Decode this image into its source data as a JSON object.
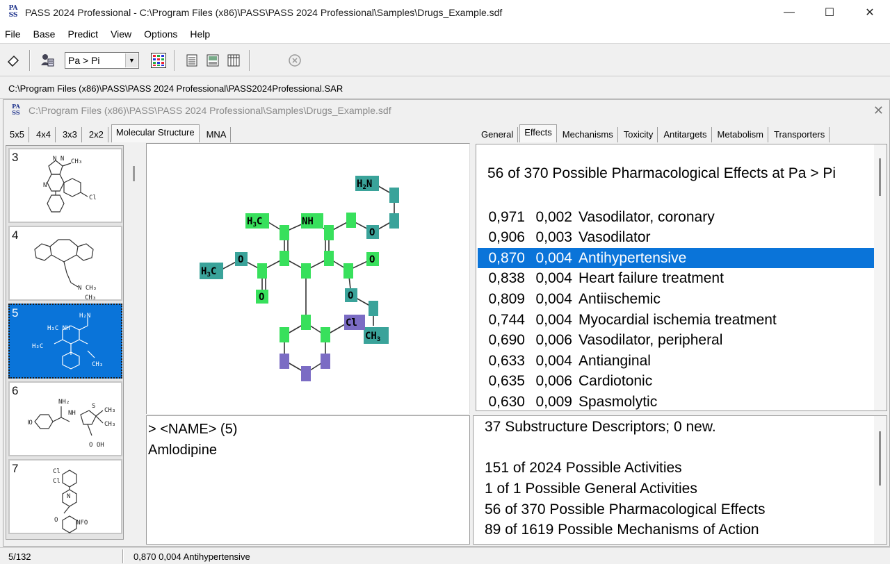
{
  "window": {
    "title": "PASS 2024 Professional - C:\\Program Files (x86)\\PASS\\PASS 2024 Professional\\Samples\\Drugs_Example.sdf",
    "app_icon_text": "PASS",
    "minimize": "—",
    "maximize": "☐",
    "close": "✕"
  },
  "menu": [
    "File",
    "Base",
    "Predict",
    "View",
    "Options",
    "Help"
  ],
  "toolbar": {
    "threshold_select": "Pa > Pi",
    "icons": [
      "eraser-icon",
      "user-settings-icon",
      "color-grid-icon",
      "document-icon",
      "image-icon",
      "table-icon",
      "stop-icon"
    ]
  },
  "sar_path": "C:\\Program Files (x86)\\PASS\\PASS 2024 Professional\\PASS2024Professional.SAR",
  "child_window": {
    "title": "C:\\Program Files (x86)\\PASS\\PASS 2024 Professional\\Samples\\Drugs_Example.sdf",
    "close": "✕"
  },
  "left_tabs": [
    "5x5",
    "4x4",
    "3x3",
    "2x2",
    "Molecular Structure",
    "MNA"
  ],
  "left_active_tab": "Molecular Structure",
  "right_tabs": [
    "General",
    "Effects",
    "Mechanisms",
    "Toxicity",
    "Antitargets",
    "Metabolism",
    "Transporters"
  ],
  "right_active_tab": "Effects",
  "thumbnails": [
    {
      "num": "3",
      "selected": false
    },
    {
      "num": "4",
      "selected": false
    },
    {
      "num": "5",
      "selected": true
    },
    {
      "num": "6",
      "selected": false
    },
    {
      "num": "7",
      "selected": false
    }
  ],
  "molecule": {
    "atom_labels": {
      "h2n": [
        "H",
        "2",
        "N"
      ],
      "h3c_top": [
        "H",
        "3",
        "C"
      ],
      "nh": "NH",
      "o": "O",
      "h3c_left": [
        "H",
        "3",
        "C"
      ],
      "cl": "Cl",
      "ch3": [
        "CH",
        "3"
      ]
    }
  },
  "name_pane": {
    "line1": ">  <NAME> (5)",
    "line2": "Amlodipine"
  },
  "effects": {
    "header": "56 of 370 Possible Pharmacological Effects at Pa > Pi",
    "rows": [
      {
        "pa": "0,971",
        "pi": "0,002",
        "name": "Vasodilator, coronary",
        "selected": false
      },
      {
        "pa": "0,906",
        "pi": "0,003",
        "name": "Vasodilator",
        "selected": false
      },
      {
        "pa": "0,870",
        "pi": "0,004",
        "name": "Antihypertensive",
        "selected": true
      },
      {
        "pa": "0,838",
        "pi": "0,004",
        "name": "Heart failure treatment",
        "selected": false
      },
      {
        "pa": "0,809",
        "pi": "0,004",
        "name": "Antiischemic",
        "selected": false
      },
      {
        "pa": "0,744",
        "pi": "0,004",
        "name": "Myocardial ischemia treatment",
        "selected": false
      },
      {
        "pa": "0,690",
        "pi": "0,006",
        "name": "Vasodilator, peripheral",
        "selected": false
      },
      {
        "pa": "0,633",
        "pi": "0,004",
        "name": "Antianginal",
        "selected": false
      },
      {
        "pa": "0,635",
        "pi": "0,006",
        "name": "Cardiotonic",
        "selected": false
      },
      {
        "pa": "0,630",
        "pi": "0,009",
        "name": "Spasmolytic",
        "selected": false
      }
    ]
  },
  "descriptors": {
    "line1": "37  Substructure Descriptors;  0  new.",
    "line2": "151 of 2024 Possible Activities",
    "line3": "1 of 1 Possible General Activities",
    "line4": "56 of 370 Possible Pharmacological Effects",
    "line5": "89 of 1619 Possible Mechanisms of Action"
  },
  "status": {
    "position": "5/132",
    "selection": "0,870  0,004  Antihypertensive"
  },
  "colors": {
    "selection": "#0a74d9",
    "atom_green": "#38e05c",
    "atom_teal": "#3aa39a",
    "atom_purple": "#7b6cc4"
  }
}
